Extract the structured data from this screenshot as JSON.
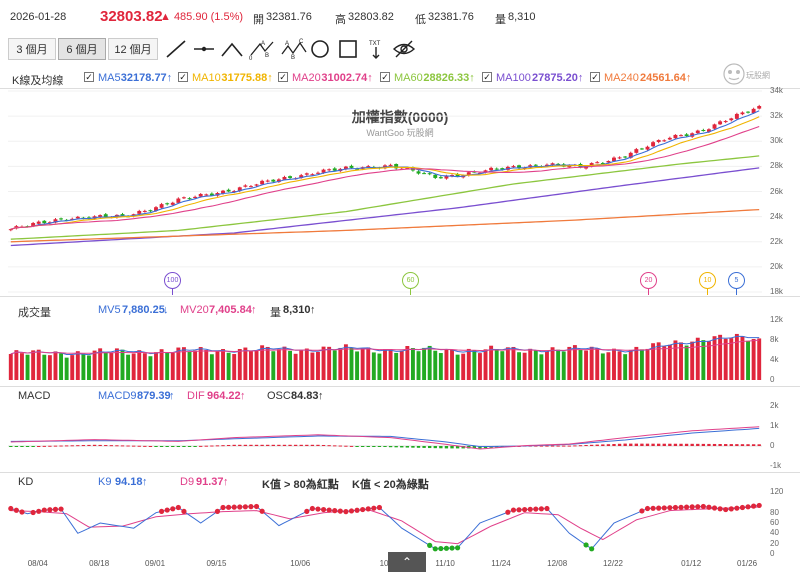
{
  "header": {
    "date": "2026-01-28",
    "price": "32803.82",
    "change": "▲ 485.90 (1.5%)",
    "open_label": "開",
    "open_value": "32381.76",
    "high_label": "高",
    "high_value": "32803.82",
    "low_label": "低",
    "low_value": "32381.76",
    "vol_label": "量",
    "vol_value": "8,310"
  },
  "toolbar": {
    "periods": [
      "3 個月",
      "6 個月",
      "12 個月"
    ],
    "active_period": "6 個月",
    "tools": [
      "line-tool-icon",
      "horizontal-line-tool-icon",
      "angle-tool-icon",
      "abc-pattern-tool-icon",
      "abcd-pattern-tool-icon",
      "circle-tool-icon",
      "rectangle-tool-icon",
      "text-tool-icon",
      "hide-drawings-icon"
    ],
    "txt_label": "TXT"
  },
  "colors": {
    "up": "#e0263c",
    "down": "#22aa22",
    "ma5": "#3b6fd6",
    "ma10": "#f0b400",
    "ma20": "#e0408a",
    "ma60": "#8cc63f",
    "ma100": "#7a4fd0",
    "ma240": "#f07a3c"
  },
  "price_legend": {
    "title": "K線及均線",
    "items": [
      {
        "label": "MA5",
        "value": "32178.77",
        "arrow": "↑",
        "color": "#3b6fd6"
      },
      {
        "label": "MA10",
        "value": "31775.88",
        "arrow": "↑",
        "color": "#f0b400"
      },
      {
        "label": "MA20",
        "value": "31002.74",
        "arrow": "↑",
        "color": "#e0408a"
      },
      {
        "label": "MA60",
        "value": "28826.33",
        "arrow": "↑",
        "color": "#8cc63f"
      },
      {
        "label": "MA100",
        "value": "27875.20",
        "arrow": "↑",
        "color": "#7a4fd0"
      },
      {
        "label": "MA240",
        "value": "24561.64",
        "arrow": "↑",
        "color": "#f07a3c"
      }
    ]
  },
  "chart_title": "加權指數(0000)",
  "watermark": "WantGoo 玩股網",
  "logo_text": "玩股網",
  "volume_legend": {
    "title": "成交量",
    "mv5_label": "MV5",
    "mv5_value": "7,880.25",
    "mv5_arrow": "↓",
    "mv20_label": "MV20",
    "mv20_value": "7,405.84",
    "mv20_arrow": "↑",
    "vol_label": "量",
    "vol_value": "8,310",
    "vol_arrow": "↑"
  },
  "macd_legend": {
    "title": "MACD",
    "macd9_label": "MACD9",
    "macd9_value": "879.39",
    "macd9_arrow": "↑",
    "dif_label": "DIF",
    "dif_value": "964.22",
    "dif_arrow": "↑",
    "osc_label": "OSC",
    "osc_value": "84.83",
    "osc_arrow": "↑"
  },
  "kd_legend": {
    "title": "KD",
    "k_label": "K9",
    "k_value": "94.18",
    "k_arrow": "↑",
    "d_label": "D9",
    "d_value": "91.37",
    "d_arrow": "↑",
    "note1": "K值 > 80為紅點",
    "note2": "K值 < 20為綠點"
  },
  "ma_badges": [
    "100",
    "60",
    "20",
    "10",
    "5"
  ],
  "chart_data": [
    {
      "type": "candlestick",
      "name": "加權指數(0000)",
      "ylim": [
        18000,
        34000
      ],
      "yticks": [
        "34k",
        "32k",
        "30k",
        "28k",
        "26k",
        "24k",
        "22k",
        "20k",
        "18k"
      ],
      "xticks": [
        "08/04",
        "08/18",
        "09/01",
        "09/15",
        "10/06",
        "10/27",
        "11/10",
        "11/24",
        "12/08",
        "12/22",
        "01/12",
        "01/26"
      ],
      "close_anchors": [
        [
          0,
          23000
        ],
        [
          10,
          23900
        ],
        [
          20,
          24000
        ],
        [
          30,
          25300
        ],
        [
          40,
          26200
        ],
        [
          55,
          27600
        ],
        [
          68,
          28100
        ],
        [
          76,
          27100
        ],
        [
          84,
          27600
        ],
        [
          96,
          28200
        ],
        [
          102,
          27900
        ],
        [
          110,
          28900
        ],
        [
          118,
          30300
        ],
        [
          124,
          30900
        ],
        [
          130,
          32000
        ],
        [
          134,
          32800
        ]
      ],
      "last_close": 32803.82,
      "ma_series": [
        {
          "name": "MA60",
          "anchors": [
            [
              0,
              22200
            ],
            [
              30,
              22900
            ],
            [
              60,
              24400
            ],
            [
              90,
              26600
            ],
            [
              120,
              28200
            ],
            [
              134,
              28830
            ]
          ]
        },
        {
          "name": "MA100",
          "anchors": [
            [
              0,
              21700
            ],
            [
              40,
              22700
            ],
            [
              80,
              24700
            ],
            [
              110,
              26500
            ],
            [
              134,
              27880
            ]
          ]
        },
        {
          "name": "MA240",
          "anchors": [
            [
              0,
              22000
            ],
            [
              60,
              22900
            ],
            [
              100,
              23700
            ],
            [
              134,
              24560
            ]
          ]
        }
      ]
    },
    {
      "type": "bar",
      "name": "成交量",
      "ylim": [
        0,
        12000
      ],
      "yticks": [
        "12k",
        "8k",
        "4k",
        "0"
      ],
      "values_anchors": [
        [
          0,
          5200
        ],
        [
          20,
          5600
        ],
        [
          40,
          6000
        ],
        [
          60,
          6200
        ],
        [
          80,
          5900
        ],
        [
          100,
          6100
        ],
        [
          112,
          6000
        ],
        [
          118,
          7200
        ],
        [
          124,
          8400
        ],
        [
          134,
          8310
        ]
      ]
    },
    {
      "type": "line",
      "name": "MACD",
      "ylim": [
        -1000,
        2000
      ],
      "yticks": [
        "2k",
        "1k",
        "0",
        "-1k"
      ],
      "dif_anchors": [
        [
          0,
          200
        ],
        [
          15,
          320
        ],
        [
          30,
          230
        ],
        [
          40,
          420
        ],
        [
          55,
          560
        ],
        [
          68,
          420
        ],
        [
          78,
          80
        ],
        [
          84,
          -150
        ],
        [
          92,
          20
        ],
        [
          100,
          100
        ],
        [
          110,
          420
        ],
        [
          122,
          760
        ],
        [
          134,
          964
        ]
      ],
      "signal_anchors": [
        [
          0,
          230
        ],
        [
          15,
          260
        ],
        [
          30,
          260
        ],
        [
          40,
          360
        ],
        [
          55,
          500
        ],
        [
          68,
          480
        ],
        [
          78,
          200
        ],
        [
          84,
          -30
        ],
        [
          92,
          0
        ],
        [
          100,
          80
        ],
        [
          110,
          300
        ],
        [
          122,
          650
        ],
        [
          134,
          879
        ]
      ]
    },
    {
      "type": "line",
      "name": "KD",
      "ylim": [
        0,
        120
      ],
      "yticks": [
        "120",
        "80",
        "60",
        "40",
        "20",
        "0"
      ],
      "k_anchors": [
        [
          0,
          88
        ],
        [
          3,
          78
        ],
        [
          6,
          85
        ],
        [
          9,
          87
        ],
        [
          12,
          40
        ],
        [
          16,
          60
        ],
        [
          22,
          50
        ],
        [
          26,
          80
        ],
        [
          30,
          90
        ],
        [
          34,
          60
        ],
        [
          38,
          90
        ],
        [
          44,
          92
        ],
        [
          48,
          55
        ],
        [
          54,
          88
        ],
        [
          60,
          82
        ],
        [
          66,
          90
        ],
        [
          70,
          50
        ],
        [
          76,
          10
        ],
        [
          80,
          12
        ],
        [
          84,
          60
        ],
        [
          90,
          85
        ],
        [
          96,
          88
        ],
        [
          100,
          40
        ],
        [
          104,
          10
        ],
        [
          108,
          60
        ],
        [
          114,
          88
        ],
        [
          124,
          92
        ],
        [
          128,
          86
        ],
        [
          134,
          94
        ]
      ],
      "d_anchors": [
        [
          0,
          84
        ],
        [
          5,
          82
        ],
        [
          10,
          78
        ],
        [
          14,
          52
        ],
        [
          20,
          54
        ],
        [
          26,
          72
        ],
        [
          32,
          78
        ],
        [
          38,
          82
        ],
        [
          44,
          84
        ],
        [
          50,
          68
        ],
        [
          56,
          80
        ],
        [
          64,
          86
        ],
        [
          70,
          64
        ],
        [
          76,
          24
        ],
        [
          80,
          20
        ],
        [
          86,
          54
        ],
        [
          92,
          80
        ],
        [
          98,
          76
        ],
        [
          102,
          50
        ],
        [
          106,
          28
        ],
        [
          112,
          66
        ],
        [
          118,
          84
        ],
        [
          126,
          88
        ],
        [
          134,
          91
        ]
      ]
    }
  ]
}
